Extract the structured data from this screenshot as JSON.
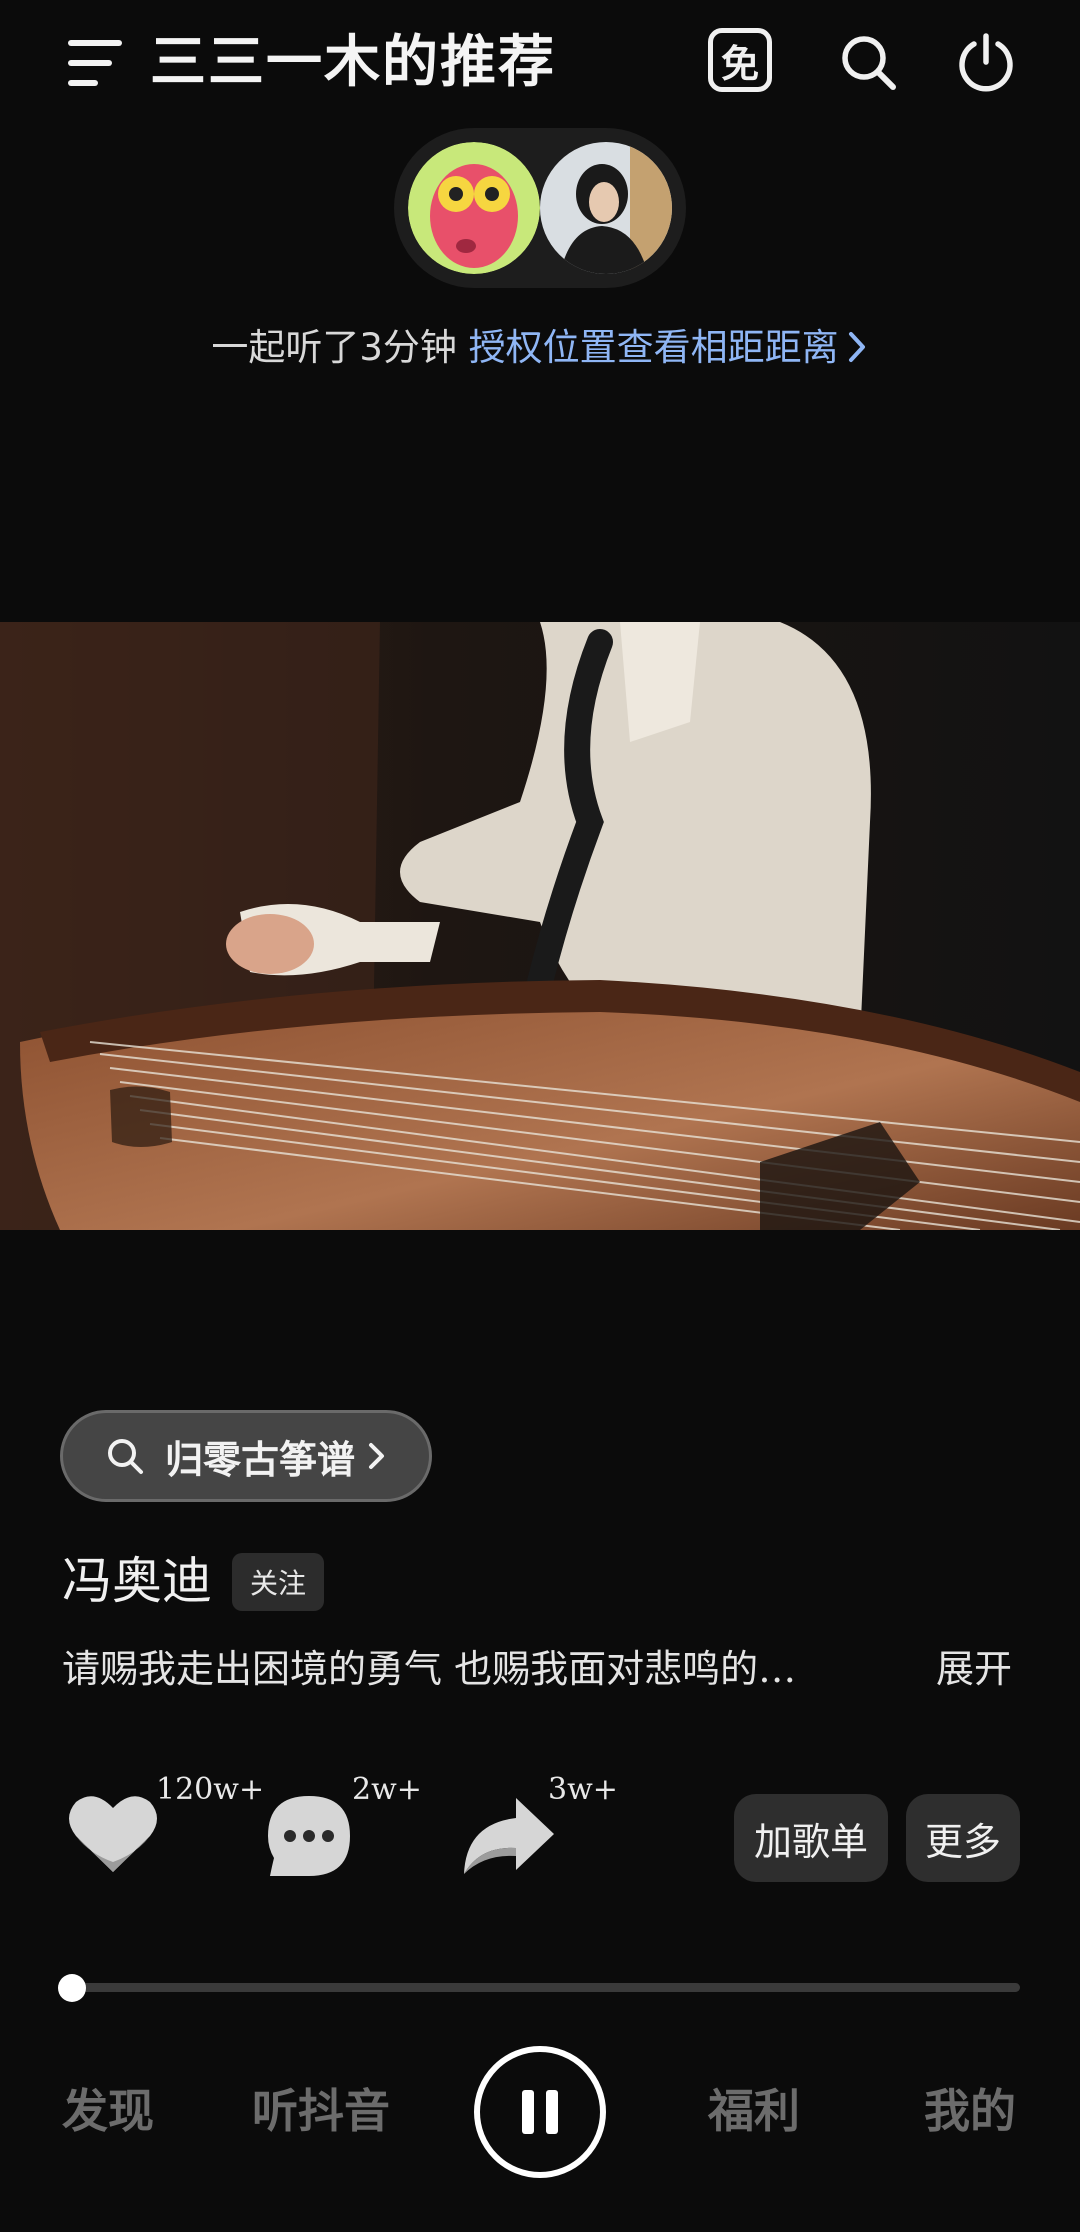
{
  "header": {
    "title": "三三一木的推荐",
    "free_badge": "免",
    "icons": [
      "menu-icon",
      "free-icon",
      "search-icon",
      "power-icon"
    ]
  },
  "together": {
    "prefix": "一起听了3分钟 ",
    "link": "授权位置查看相距距离",
    "link_color": "#8fb6f5"
  },
  "search_chip": {
    "label": "归零古筝谱",
    "icon": "search-icon"
  },
  "artist": {
    "name": "冯奥迪",
    "follow_label": "关注"
  },
  "lyric": {
    "text": "请赐我走出困境的勇气  也赐我面对悲鸣的…",
    "expand_label": "展开"
  },
  "actions": {
    "like_count": "120w+",
    "comment_count": "2w+",
    "share_count": "3w+",
    "add_playlist_label": "加歌单",
    "more_label": "更多"
  },
  "player": {
    "progress_fraction": 0.01,
    "state": "playing"
  },
  "bottom_nav": {
    "items": [
      "发现",
      "听抖音",
      "福利",
      "我的"
    ]
  },
  "colors": {
    "background": "#0b0b0b",
    "chip_background": "#454545",
    "nav_inactive": "#6c6c6c"
  }
}
